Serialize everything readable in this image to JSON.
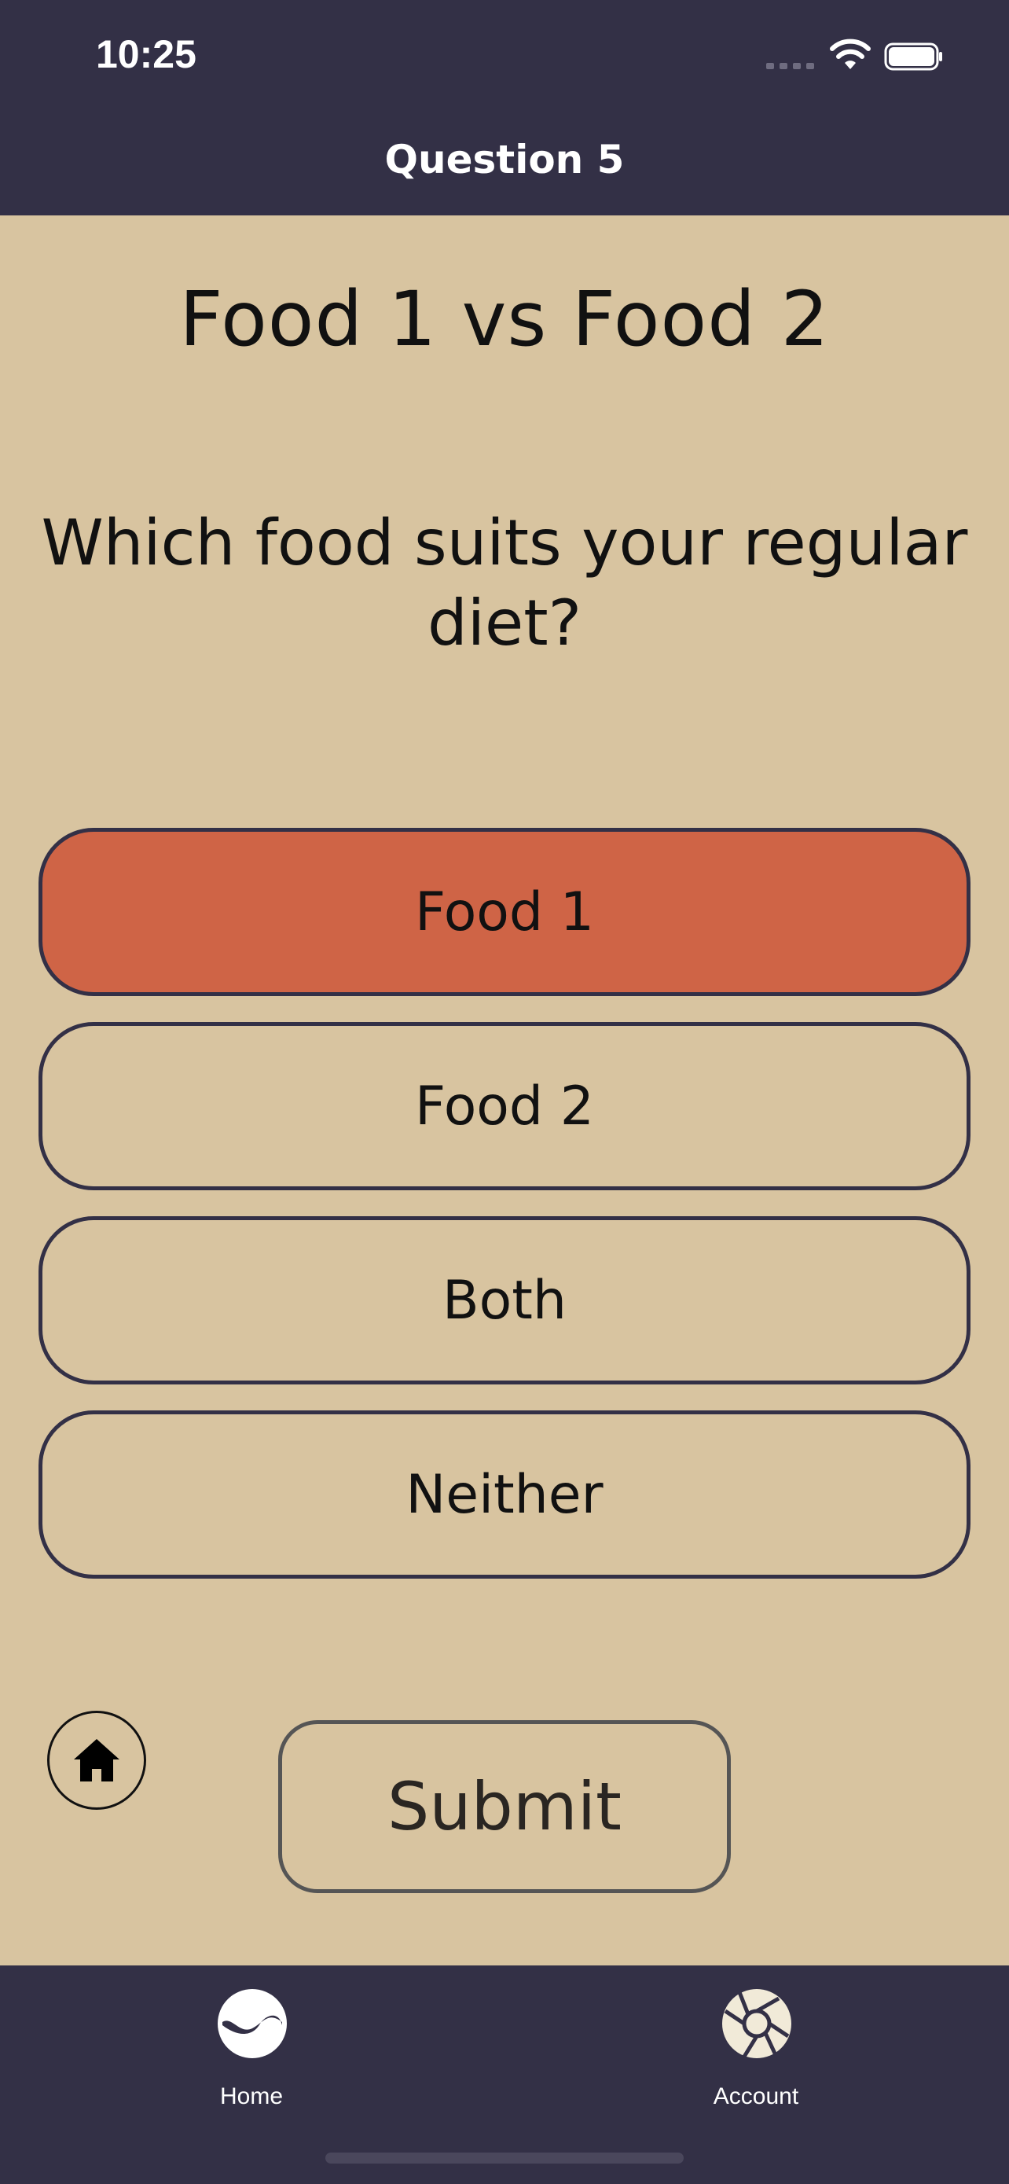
{
  "status_bar": {
    "time": "10:25",
    "icons": [
      "cellular-signal-icon",
      "wifi-icon",
      "battery-icon"
    ]
  },
  "nav": {
    "title": "Question 5"
  },
  "content": {
    "title": "Food 1 vs Food 2",
    "question": "Which food suits your regular diet?"
  },
  "options": [
    {
      "label": "Food 1",
      "selected": true
    },
    {
      "label": "Food 2",
      "selected": false
    },
    {
      "label": "Both",
      "selected": false
    },
    {
      "label": "Neither",
      "selected": false
    }
  ],
  "actions": {
    "submit_label": "Submit",
    "home_icon": "house-icon"
  },
  "tab_bar": {
    "items": [
      {
        "label": "Home",
        "icon": "wave-circle-icon"
      },
      {
        "label": "Account",
        "icon": "aperture-icon"
      }
    ]
  },
  "colors": {
    "background": "#d8c4a0",
    "bars": "#333046",
    "selected_option": "#cf6446",
    "option_border": "#333046"
  }
}
